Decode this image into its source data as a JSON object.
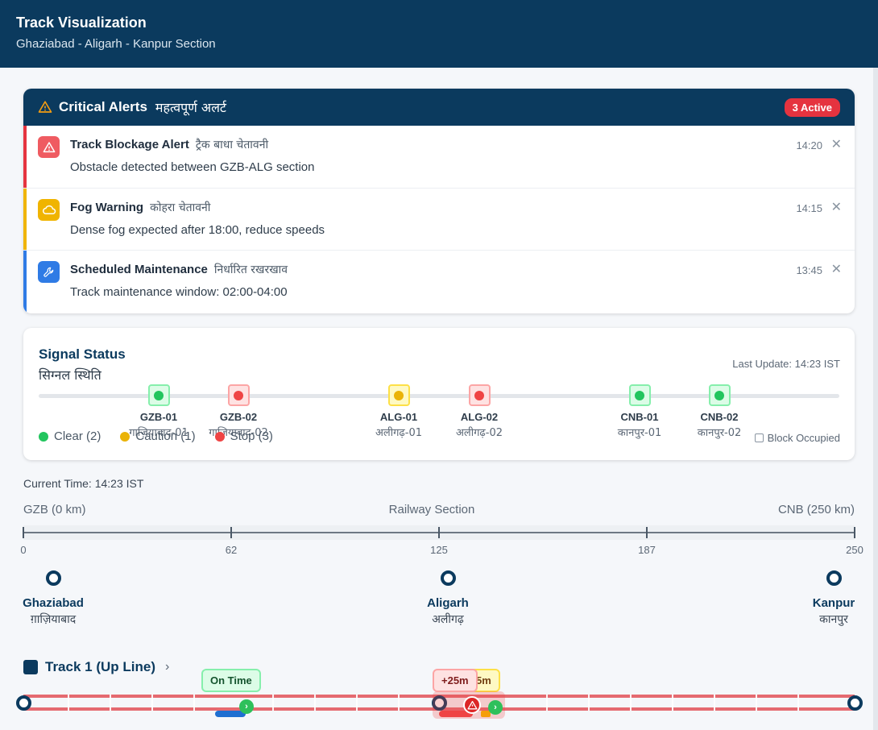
{
  "header": {
    "title": "Track Visualization",
    "subtitle": "Ghaziabad - Aligarh - Kanpur Section"
  },
  "alerts": {
    "title": "Critical Alerts",
    "title_hi": "महत्वपूर्ण अलर्ट",
    "badge": "3 Active",
    "items": [
      {
        "title": "Track Blockage Alert",
        "title_hi": "ट्रैक बाधा चेतावनी",
        "message": "Obstacle detected between GZB-ALG section",
        "time": "14:20",
        "close": "✕",
        "icon": "warning-triangle-icon",
        "color": "#e5333f"
      },
      {
        "title": "Fog Warning",
        "title_hi": "कोहरा चेतावनी",
        "message": "Dense fog expected after 18:00, reduce speeds",
        "time": "14:15",
        "close": "✕",
        "icon": "cloud-icon",
        "color": "#f0b400"
      },
      {
        "title": "Scheduled Maintenance",
        "title_hi": "निर्धारित रखरखाव",
        "message": "Track maintenance window: 02:00-04:00",
        "time": "13:45",
        "close": "✕",
        "icon": "wrench-icon",
        "color": "#2f7be5"
      }
    ]
  },
  "signals": {
    "title": "Signal Status",
    "title_hi": "सिग्नल स्थिति",
    "last_update": "Last Update: 14:23 IST",
    "items": [
      {
        "code": "GZB-01",
        "name_hi": "गाज़ियाबाद-01",
        "status": "clear"
      },
      {
        "code": "GZB-02",
        "name_hi": "गाज़ियाबाद-02",
        "status": "stop"
      },
      {
        "code": "ALG-01",
        "name_hi": "अलीगढ़-01",
        "status": "caution"
      },
      {
        "code": "ALG-02",
        "name_hi": "अलीगढ़-02",
        "status": "stop"
      },
      {
        "code": "CNB-01",
        "name_hi": "कानपुर-01",
        "status": "clear"
      },
      {
        "code": "CNB-02",
        "name_hi": "कानपुर-02",
        "status": "clear"
      }
    ],
    "legend": {
      "clear": "Clear (2)",
      "caution": "Caution (1)",
      "stop": "Stop (3)"
    },
    "block_occupied": "Block Occupied",
    "colors": {
      "clear": "#22c55e",
      "caution": "#eab308",
      "stop": "#ef4444"
    }
  },
  "timeline": {
    "current_time": "Current Time: 14:23 IST",
    "left_label": "GZB (0 km)",
    "center_label": "Railway Section",
    "right_label": "CNB (250 km)",
    "ticks": [
      "0",
      "62",
      "125",
      "187",
      "250"
    ]
  },
  "stations": [
    {
      "name": "Ghaziabad",
      "name_hi": "ग़ाज़ियाबाद"
    },
    {
      "name": "Aligarh",
      "name_hi": "अलीगढ़"
    },
    {
      "name": "Kanpur",
      "name_hi": "कानपुर"
    }
  ],
  "track": {
    "title": "Track 1 (Up Line)",
    "chevron": "›",
    "tags": {
      "on_time": "On Time",
      "delay_a": "+25m",
      "delay_b": "5m"
    },
    "go_glyph": "›"
  }
}
